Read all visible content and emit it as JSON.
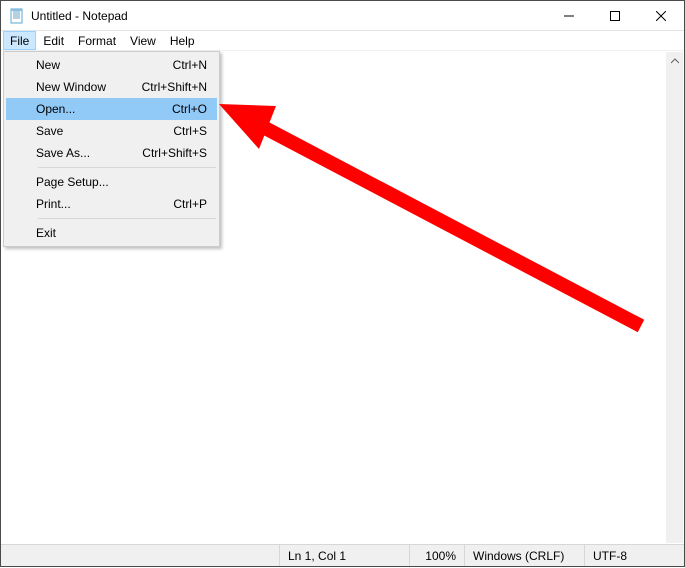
{
  "window": {
    "title": "Untitled - Notepad"
  },
  "menubar": {
    "items": [
      "File",
      "Edit",
      "Format",
      "View",
      "Help"
    ],
    "active_index": 0
  },
  "dropdown": {
    "items": [
      {
        "label": "New",
        "shortcut": "Ctrl+N",
        "highlighted": false
      },
      {
        "label": "New Window",
        "shortcut": "Ctrl+Shift+N",
        "highlighted": false
      },
      {
        "label": "Open...",
        "shortcut": "Ctrl+O",
        "highlighted": true
      },
      {
        "label": "Save",
        "shortcut": "Ctrl+S",
        "highlighted": false
      },
      {
        "label": "Save As...",
        "shortcut": "Ctrl+Shift+S",
        "highlighted": false
      }
    ],
    "items2": [
      {
        "label": "Page Setup...",
        "shortcut": "",
        "highlighted": false
      },
      {
        "label": "Print...",
        "shortcut": "Ctrl+P",
        "highlighted": false
      }
    ],
    "items3": [
      {
        "label": "Exit",
        "shortcut": "",
        "highlighted": false
      }
    ]
  },
  "statusbar": {
    "position": "Ln 1, Col 1",
    "zoom": "100%",
    "line_ending": "Windows (CRLF)",
    "encoding": "UTF-8"
  },
  "annotation": {
    "arrow_color": "#ff0000"
  }
}
